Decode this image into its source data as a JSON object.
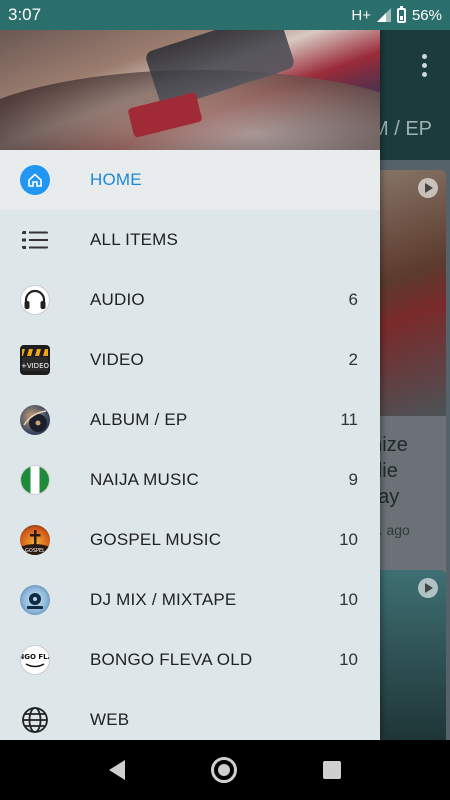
{
  "status": {
    "time": "3:07",
    "network": "H+",
    "battery": "56%"
  },
  "background": {
    "tab_label": "M / EP",
    "card_title": "onize\nodie\nWay",
    "card_time": "nin. ago"
  },
  "drawer": {
    "items": [
      {
        "label": "HOME",
        "count": "",
        "icon": "home-icon",
        "active": true
      },
      {
        "label": "ALL ITEMS",
        "count": "",
        "icon": "list-icon"
      },
      {
        "label": "AUDIO",
        "count": "6",
        "icon": "headphones-icon"
      },
      {
        "label": "VIDEO",
        "count": "2",
        "icon": "video-clapper-icon"
      },
      {
        "label": "ALBUM / EP",
        "count": "11",
        "icon": "album-icon"
      },
      {
        "label": "NAIJA MUSIC",
        "count": "9",
        "icon": "nigeria-flag-icon"
      },
      {
        "label": "GOSPEL MUSIC",
        "count": "10",
        "icon": "gospel-icon"
      },
      {
        "label": "DJ MIX / MIXTAPE",
        "count": "10",
        "icon": "dj-mix-icon"
      },
      {
        "label": "BONGO FLEVA OLD",
        "count": "10",
        "icon": "bongo-fleva-icon"
      },
      {
        "label": "WEB",
        "count": "",
        "icon": "globe-icon"
      }
    ]
  },
  "icon_text": {
    "video": "+VIDEO",
    "gospel": "GOSPEL",
    "bongo": "BONGO FLAVA"
  },
  "colors": {
    "accent": "#1e88d8",
    "statusbar": "#2a6f6b",
    "drawer_bg": "#dde6e9"
  }
}
